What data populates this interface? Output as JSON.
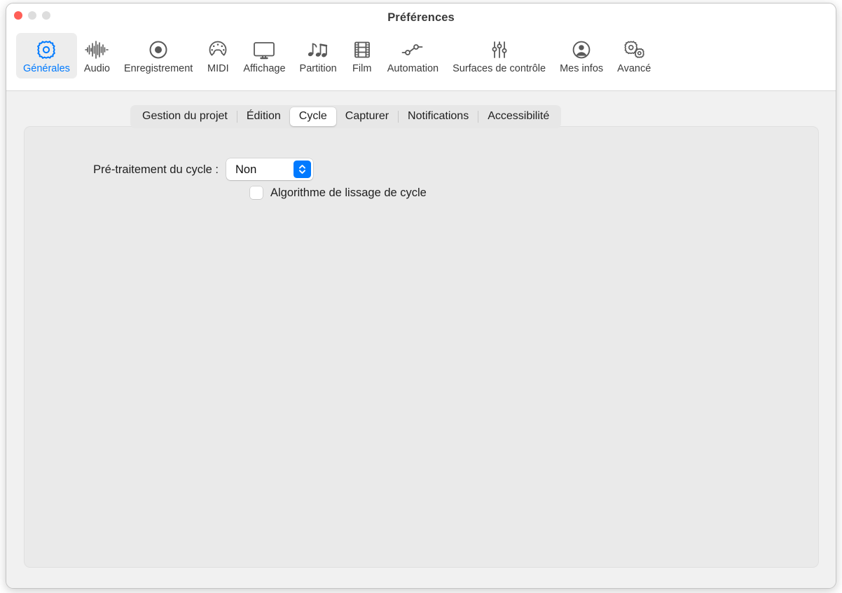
{
  "window": {
    "title": "Préférences",
    "traffic_lights": [
      {
        "name": "close",
        "color": "#ff5f57"
      },
      {
        "name": "minimize",
        "color": "#dddddd"
      },
      {
        "name": "zoom",
        "color": "#dddddd"
      }
    ]
  },
  "toolbar": {
    "items": [
      {
        "label": "Générales",
        "icon": "gear-icon",
        "selected": true
      },
      {
        "label": "Audio",
        "icon": "waveform-icon",
        "selected": false
      },
      {
        "label": "Enregistrement",
        "icon": "record-icon",
        "selected": false
      },
      {
        "label": "MIDI",
        "icon": "midi-connector-icon",
        "selected": false
      },
      {
        "label": "Affichage",
        "icon": "display-icon",
        "selected": false
      },
      {
        "label": "Partition",
        "icon": "music-notes-icon",
        "selected": false
      },
      {
        "label": "Film",
        "icon": "film-strip-icon",
        "selected": false
      },
      {
        "label": "Automation",
        "icon": "automation-nodes-icon",
        "selected": false
      },
      {
        "label": "Surfaces de contrôle",
        "icon": "sliders-icon",
        "selected": false
      },
      {
        "label": "Mes infos",
        "icon": "person-circle-icon",
        "selected": false
      },
      {
        "label": "Avancé",
        "icon": "double-gear-icon",
        "selected": false
      }
    ],
    "accent_color": "#007aff",
    "icon_color": "#595959"
  },
  "tabs": {
    "items": [
      {
        "label": "Gestion du projet",
        "selected": false
      },
      {
        "label": "Édition",
        "selected": false
      },
      {
        "label": "Cycle",
        "selected": true
      },
      {
        "label": "Capturer",
        "selected": false
      },
      {
        "label": "Notifications",
        "selected": false
      },
      {
        "label": "Accessibilité",
        "selected": false
      }
    ]
  },
  "content": {
    "preprocess_label": "Pré-traitement du cycle :",
    "preprocess_value": "Non",
    "preprocess_options": [
      "Non"
    ],
    "smoothing_checkbox_label": "Algorithme de lissage de cycle",
    "smoothing_checked": false
  }
}
